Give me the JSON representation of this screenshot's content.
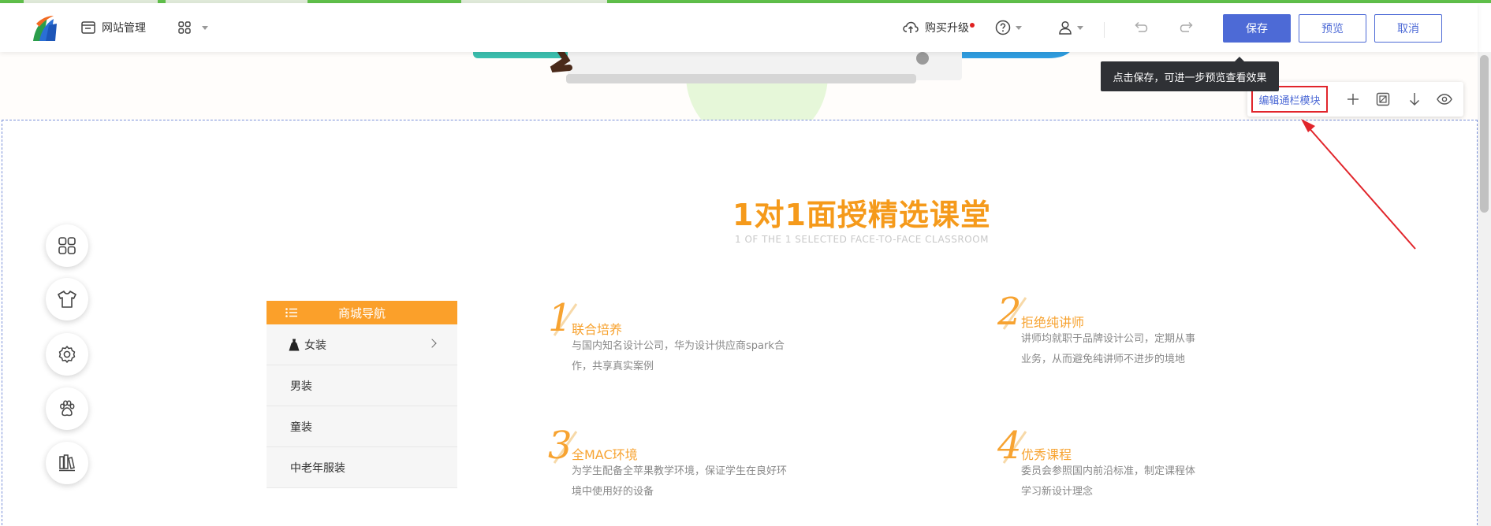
{
  "toolbar": {
    "site_manage_label": "网站管理",
    "upgrade_label": "购买升级",
    "save_label": "保存",
    "preview_label": "预览",
    "cancel_label": "取消"
  },
  "tooltip": {
    "text": "点击保存，可进一步预览查看效果"
  },
  "module_bar": {
    "edit_label": "编辑通栏模块"
  },
  "section": {
    "title": "1对1面授精选课堂",
    "subtitle": "1 OF THE 1 SELECTED FACE-TO-FACE CLASSROOM"
  },
  "shop_nav": {
    "title": "商城导航",
    "items": [
      {
        "label": "女装"
      },
      {
        "label": "男装"
      },
      {
        "label": "童装"
      },
      {
        "label": "中老年服装"
      }
    ]
  },
  "features": [
    {
      "num": "1",
      "title": "联合培养",
      "line1": "与国内知名设计公司，华为设计供应商spark合",
      "line2": "作，共享真实案例"
    },
    {
      "num": "2",
      "title": "拒绝纯讲师",
      "line1": "讲师均就职于品牌设计公司，定期从事",
      "line2": "业务，从而避免纯讲师不进步的境地"
    },
    {
      "num": "3",
      "title": "全MAC环境",
      "line1": "为学生配备全苹果教学环境，保证学生在良好环",
      "line2": "境中使用好的设备"
    },
    {
      "num": "4",
      "title": "优秀课程",
      "line1": "委员会参照国内前沿标准，制定课程体",
      "line2": "学习新设计理念"
    }
  ],
  "colors": {
    "accent_blue": "#4d6ad6",
    "orange": "#f59a1b",
    "nav_orange": "#fba02a",
    "annotation_red": "#e1252b"
  }
}
